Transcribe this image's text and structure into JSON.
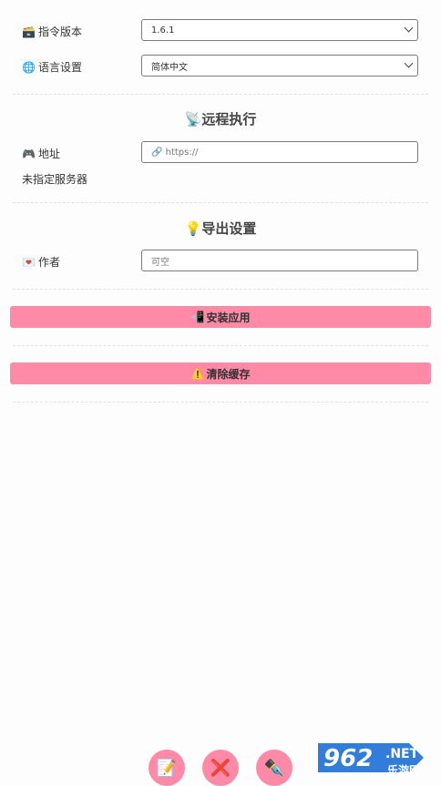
{
  "settings": {
    "instruction_version": {
      "icon": "🗃️",
      "label": "指令版本",
      "value": "1.6.1"
    },
    "language": {
      "icon": "🌐",
      "label": "语言设置",
      "value": "简体中文"
    }
  },
  "remote": {
    "title_icon": "📡",
    "title": "远程执行",
    "address": {
      "icon": "🎮",
      "label": "地址",
      "placeholder": "🔗 https://"
    },
    "status": "未指定服务器"
  },
  "export": {
    "title_icon": "💡",
    "title": "导出设置",
    "author": {
      "icon": "💌",
      "label": "作者",
      "placeholder": "可空"
    }
  },
  "actions": {
    "install": {
      "icon": "📲",
      "label": "安装应用"
    },
    "clear_cache": {
      "icon": "⚠️",
      "label": "清除缓存"
    }
  },
  "fabs": {
    "edit": "📝",
    "close": "❌",
    "pen": "✒️"
  },
  "watermark": {
    "brand": "962",
    "suffix": ".NET",
    "site": "乐游网"
  },
  "colors": {
    "accent": "#ff8aa8",
    "watermark_blue": "#1d6fd6"
  }
}
